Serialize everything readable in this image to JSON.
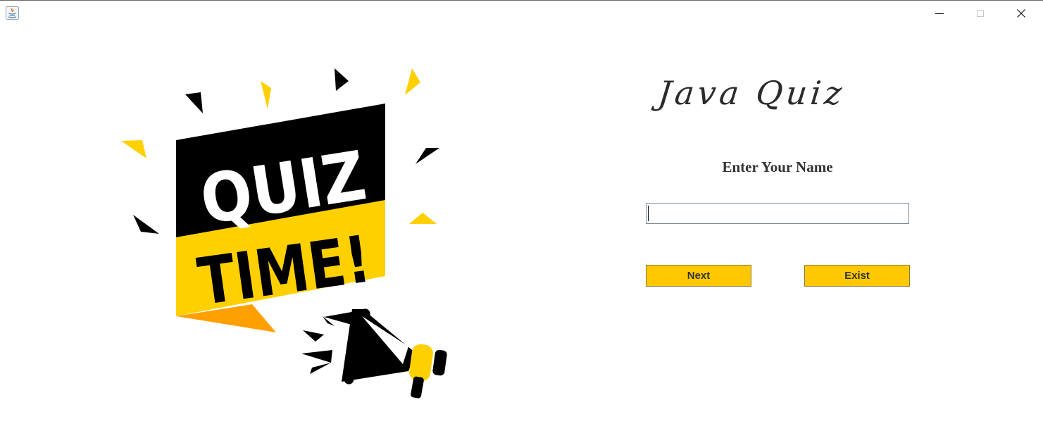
{
  "window": {
    "controls": {
      "minimize_icon": "minimize-icon",
      "maximize_icon": "maximize-icon",
      "close_icon": "close-icon"
    }
  },
  "illustration": {
    "banner_top": "QUIZ",
    "banner_bottom": "TIME!",
    "colors": {
      "black": "#000000",
      "yellow": "#ffd000",
      "orange": "#ffa000",
      "white": "#ffffff"
    }
  },
  "main": {
    "title": "Java Quiz",
    "name_label": "Enter Your Name",
    "name_input_value": "",
    "next_label": "Next",
    "exist_label": "Exist"
  },
  "colors": {
    "button_bg": "#ffc800",
    "text": "#333333"
  }
}
